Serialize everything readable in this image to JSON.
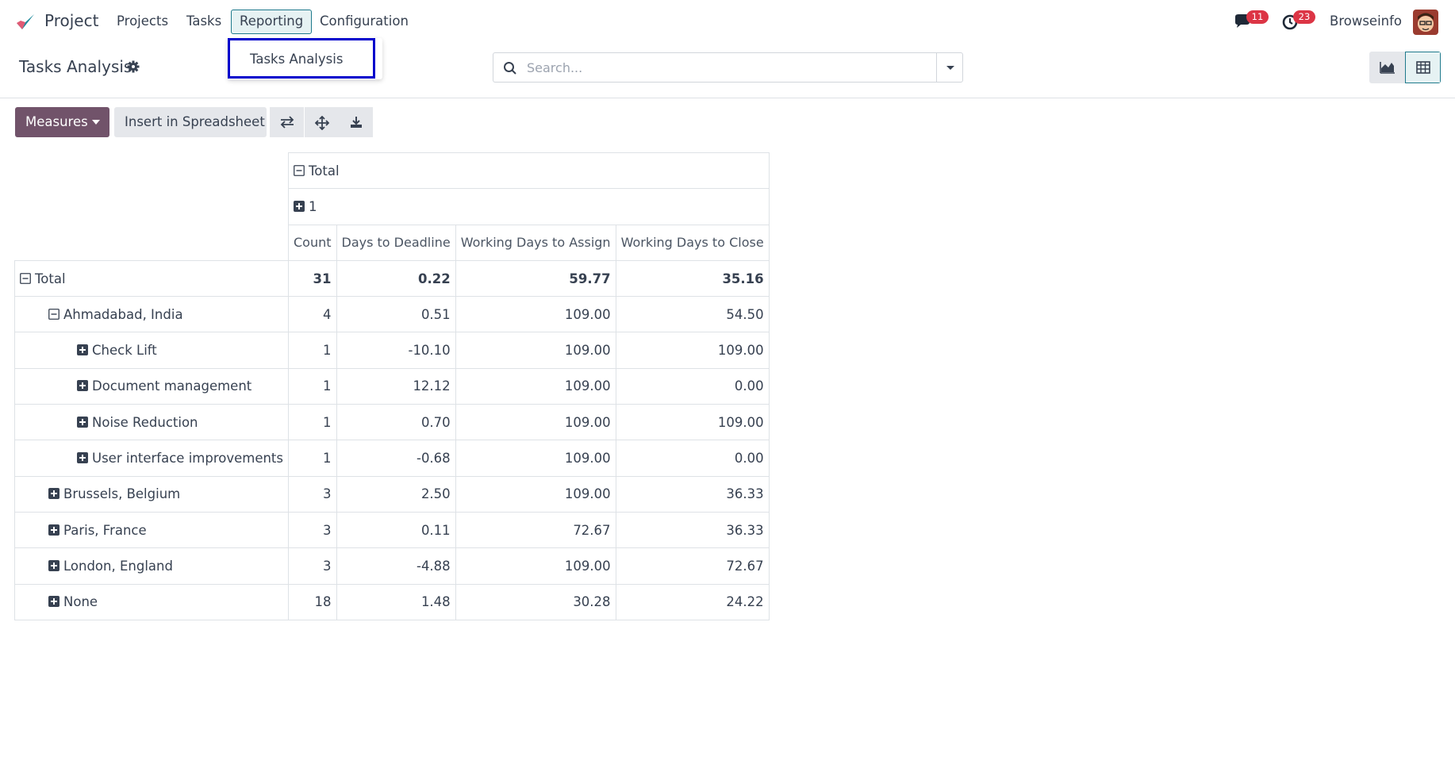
{
  "app": {
    "name": "Project",
    "menu": [
      {
        "label": "Projects"
      },
      {
        "label": "Tasks"
      },
      {
        "label": "Reporting"
      },
      {
        "label": "Configuration"
      }
    ],
    "messages_count": "11",
    "activities_count": "23",
    "user_name": "Browseinfo"
  },
  "dropdown": {
    "items": [
      {
        "label": "Tasks Analysis"
      }
    ]
  },
  "control_panel": {
    "title": "Tasks Analysis",
    "search_placeholder": "Search..."
  },
  "toolbar": {
    "measures_label": "Measures",
    "insert_label": "Insert in Spreadsheet"
  },
  "pivot": {
    "col_header_total": "Total",
    "col_header_group": "1",
    "measures": [
      "Count",
      "Days to Deadline",
      "Working Days to Assign",
      "Working Days to Close"
    ],
    "rows": [
      {
        "label": "Total",
        "level": 1,
        "expanded": true,
        "values": [
          "31",
          "0.22",
          "59.77",
          "35.16"
        ]
      },
      {
        "label": "Ahmadabad, India",
        "level": 2,
        "expanded": true,
        "values": [
          "4",
          "0.51",
          "109.00",
          "54.50"
        ]
      },
      {
        "label": "Check Lift",
        "level": 3,
        "expanded": false,
        "values": [
          "1",
          "-10.10",
          "109.00",
          "109.00"
        ]
      },
      {
        "label": "Document management",
        "level": 3,
        "expanded": false,
        "values": [
          "1",
          "12.12",
          "109.00",
          "0.00"
        ]
      },
      {
        "label": "Noise Reduction",
        "level": 3,
        "expanded": false,
        "values": [
          "1",
          "0.70",
          "109.00",
          "109.00"
        ]
      },
      {
        "label": "User interface improvements",
        "level": 3,
        "expanded": false,
        "values": [
          "1",
          "-0.68",
          "109.00",
          "0.00"
        ]
      },
      {
        "label": "Brussels, Belgium",
        "level": 2,
        "expanded": false,
        "values": [
          "3",
          "2.50",
          "109.00",
          "36.33"
        ]
      },
      {
        "label": "Paris, France",
        "level": 2,
        "expanded": false,
        "values": [
          "3",
          "0.11",
          "72.67",
          "36.33"
        ]
      },
      {
        "label": "London, England",
        "level": 2,
        "expanded": false,
        "values": [
          "3",
          "-4.88",
          "109.00",
          "72.67"
        ]
      },
      {
        "label": "None",
        "level": 2,
        "expanded": false,
        "values": [
          "18",
          "1.48",
          "30.28",
          "24.22"
        ]
      }
    ]
  },
  "colors": {
    "primary": "#71536a",
    "active_outline": "#1f7a8c",
    "badge": "#dc3545",
    "highlight_box": "#0000cc"
  }
}
